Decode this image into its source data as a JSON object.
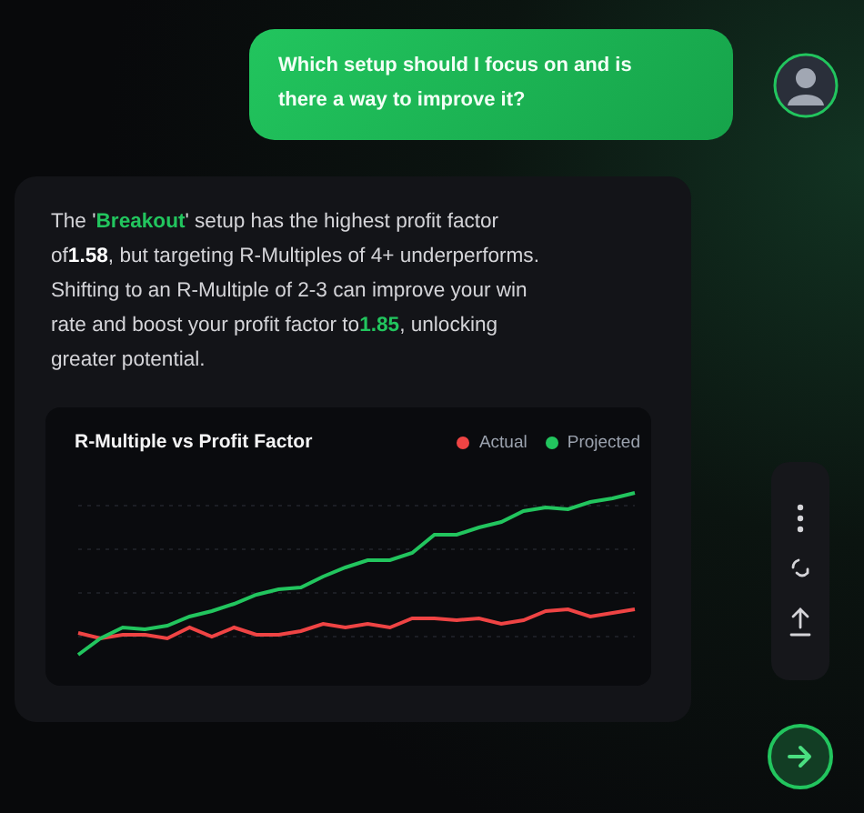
{
  "user_message": {
    "text": "Which setup should I focus on and is there a way to improve it?"
  },
  "answer": {
    "segments": [
      {
        "kind": "plain",
        "text": "The '"
      },
      {
        "kind": "highlight",
        "text": "Breakout"
      },
      {
        "kind": "plain",
        "text": "' setup has the highest profit factor of"
      },
      {
        "kind": "bold",
        "text": "1.58"
      },
      {
        "kind": "plain",
        "text": ", but targeting R-Multiples of 4+ underperforms. Shifting to an R-Multiple of 2-3 can improve your win rate and boost your profit factor to"
      },
      {
        "kind": "highlight",
        "text": "1.85"
      },
      {
        "kind": "plain",
        "text": ", unlocking greater potential."
      }
    ],
    "chart": {
      "title": "R-Multiple vs Profit Factor",
      "legend": [
        {
          "label": "Actual",
          "color": "#ef4444"
        },
        {
          "label": "Projected",
          "color": "#22c55e"
        }
      ]
    }
  }
}
